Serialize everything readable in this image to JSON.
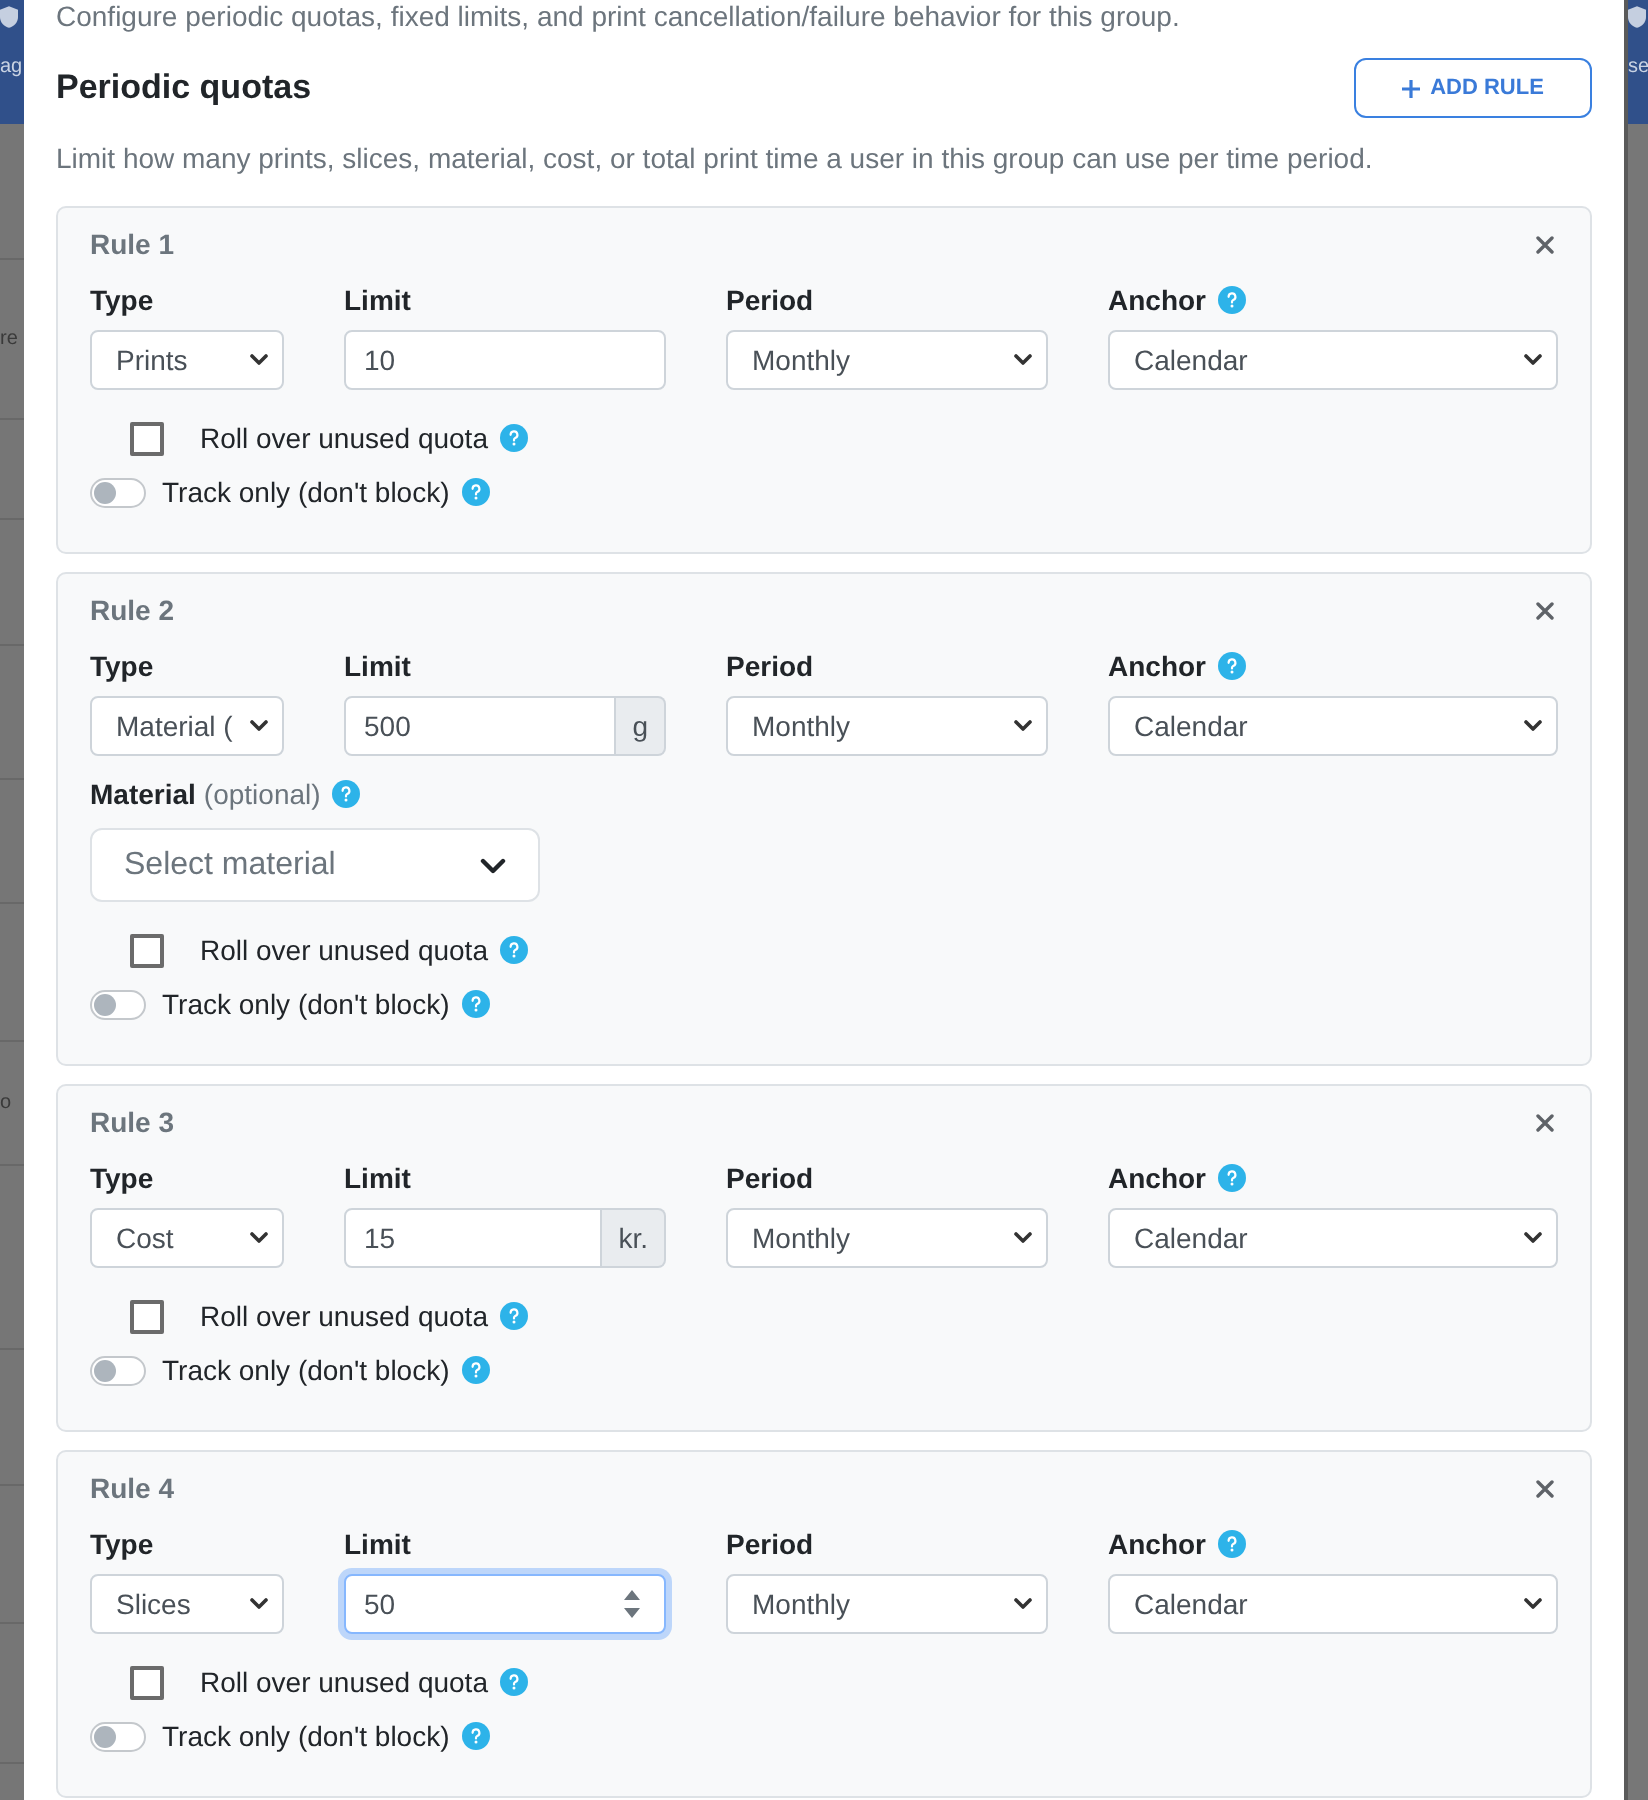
{
  "background": {
    "left_header_text": "ag",
    "right_header_text": "se",
    "left_texts": [
      "re",
      "o"
    ]
  },
  "intro": "Configure periodic quotas, fixed limits, and print cancellation/failure behavior for this group.",
  "section": {
    "title": "Periodic quotas",
    "add_button": "ADD RULE",
    "description": "Limit how many prints, slices, material, cost, or total print time a user in this group can use per time period."
  },
  "rules": [
    {
      "title": "Rule 1",
      "type": {
        "label": "Type",
        "value": "Prints"
      },
      "limit": {
        "label": "Limit",
        "value": "10",
        "kind": "plain",
        "focused": false
      },
      "period": {
        "label": "Period",
        "value": "Monthly"
      },
      "anchor": {
        "label": "Anchor",
        "value": "Calendar"
      },
      "rollover": {
        "label": "Roll over unused quota",
        "checked": false
      },
      "track_only": {
        "label": "Track only (don't block)",
        "on": false
      }
    },
    {
      "title": "Rule 2",
      "type": {
        "label": "Type",
        "value": "Material ("
      },
      "limit": {
        "label": "Limit",
        "value": "500",
        "kind": "unit",
        "unit": "g",
        "focused": false
      },
      "period": {
        "label": "Period",
        "value": "Monthly"
      },
      "anchor": {
        "label": "Anchor",
        "value": "Calendar"
      },
      "material": {
        "label": "Material",
        "hint": "(optional)",
        "placeholder": "Select material"
      },
      "rollover": {
        "label": "Roll over unused quota",
        "checked": false
      },
      "track_only": {
        "label": "Track only (don't block)",
        "on": false
      }
    },
    {
      "title": "Rule 3",
      "type": {
        "label": "Type",
        "value": "Cost"
      },
      "limit": {
        "label": "Limit",
        "value": "15",
        "kind": "unit",
        "unit": "kr.",
        "focused": false
      },
      "period": {
        "label": "Period",
        "value": "Monthly"
      },
      "anchor": {
        "label": "Anchor",
        "value": "Calendar"
      },
      "rollover": {
        "label": "Roll over unused quota",
        "checked": false
      },
      "track_only": {
        "label": "Track only (don't block)",
        "on": false
      }
    },
    {
      "title": "Rule 4",
      "type": {
        "label": "Type",
        "value": "Slices"
      },
      "limit": {
        "label": "Limit",
        "value": "50",
        "kind": "plain",
        "focused": true
      },
      "period": {
        "label": "Period",
        "value": "Monthly"
      },
      "anchor": {
        "label": "Anchor",
        "value": "Calendar"
      },
      "rollover": {
        "label": "Roll over unused quota",
        "checked": false
      },
      "track_only": {
        "label": "Track only (don't block)",
        "on": false
      }
    }
  ]
}
